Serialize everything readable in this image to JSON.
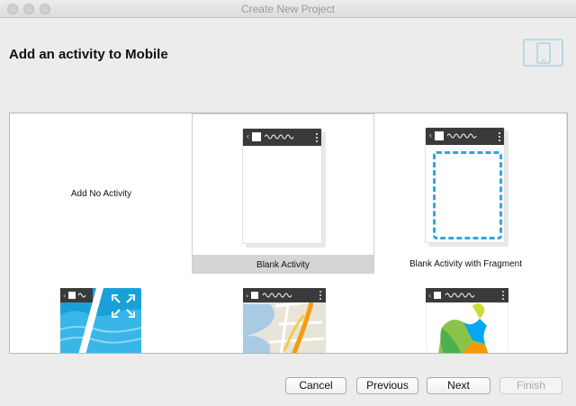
{
  "window": {
    "title": "Create New Project"
  },
  "header": {
    "heading": "Add an activity to Mobile",
    "icon": "phone-tablet-icon"
  },
  "gallery": {
    "tiles": [
      {
        "label": "Add No Activity",
        "selected": false
      },
      {
        "label": "Blank Activity",
        "selected": true
      },
      {
        "label": "Blank Activity with Fragment",
        "selected": false
      },
      {
        "label": "",
        "selected": false,
        "thumbnail": "fullscreen-activity-thumbnail"
      },
      {
        "label": "",
        "selected": false,
        "thumbnail": "maps-activity-thumbnail"
      },
      {
        "label": "",
        "selected": false,
        "thumbnail": "play-services-activity-thumbnail"
      }
    ]
  },
  "footer": {
    "cancel_label": "Cancel",
    "previous_label": "Previous",
    "next_label": "Next",
    "finish_label": "Finish",
    "finish_enabled": false
  }
}
